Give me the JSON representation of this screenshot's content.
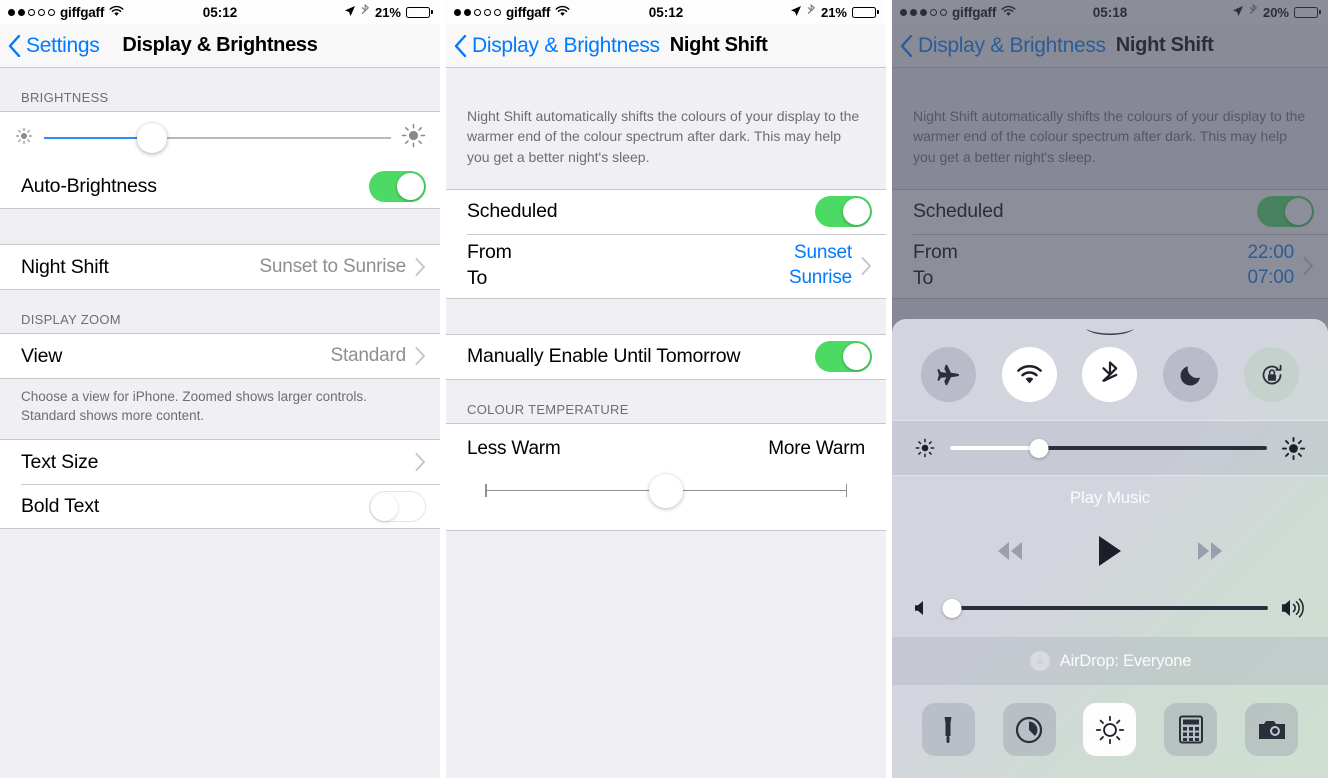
{
  "panels": [
    {
      "status": {
        "carrier": "giffgaff",
        "signal_dots_filled": 2,
        "signal_dots_total": 5,
        "time": "05:12",
        "battery_percent": "21%",
        "battery_level": 21,
        "icons": [
          "wifi-icon",
          "location-arrow-icon",
          "bluetooth-icon",
          "battery-icon"
        ]
      },
      "nav": {
        "back_label": "Settings",
        "title": "Display & Brightness"
      },
      "brightness_header": "BRIGHTNESS",
      "brightness_slider": {
        "value": 31,
        "min_icon": "sun-small-icon",
        "max_icon": "sun-large-icon"
      },
      "auto_brightness": {
        "label": "Auto-Brightness",
        "state": "on"
      },
      "night_shift": {
        "label": "Night Shift",
        "value": "Sunset to Sunrise"
      },
      "display_zoom_header": "DISPLAY ZOOM",
      "view": {
        "label": "View",
        "value": "Standard"
      },
      "view_footnote": "Choose a view for iPhone. Zoomed shows larger controls. Standard shows more content.",
      "text_size": {
        "label": "Text Size"
      },
      "bold_text": {
        "label": "Bold Text",
        "state": "off"
      }
    },
    {
      "status": {
        "carrier": "giffgaff",
        "signal_dots_filled": 2,
        "signal_dots_total": 5,
        "time": "05:12",
        "battery_percent": "21%",
        "battery_level": 21
      },
      "nav": {
        "back_label": "Display & Brightness",
        "title": "Night Shift"
      },
      "description": "Night Shift automatically shifts the colours of your display to the warmer end of the colour spectrum after dark. This may help you get a better night's sleep.",
      "scheduled": {
        "label": "Scheduled",
        "state": "on"
      },
      "schedule": {
        "from_label": "From",
        "to_label": "To",
        "from_value": "Sunset",
        "to_value": "Sunrise"
      },
      "manual": {
        "label": "Manually Enable Until Tomorrow",
        "state": "on"
      },
      "colour_temp_header": "COLOUR TEMPERATURE",
      "colour_temp": {
        "min_label": "Less Warm",
        "max_label": "More Warm",
        "value": 50
      }
    },
    {
      "status": {
        "carrier": "giffgaff",
        "signal_dots_filled": 3,
        "signal_dots_total": 5,
        "time": "05:18",
        "battery_percent": "20%",
        "battery_level": 20
      },
      "nav": {
        "back_label": "Display & Brightness",
        "title": "Night Shift"
      },
      "description": "Night Shift automatically shifts the colours of your display to the warmer end of the colour spectrum after dark. This may help you get a better night's sleep.",
      "scheduled": {
        "label": "Scheduled",
        "state": "on"
      },
      "schedule": {
        "from_label": "From",
        "to_label": "To",
        "from_value": "22:00",
        "to_value": "07:00"
      },
      "control_center": {
        "toggles": [
          {
            "name": "airplane-mode-icon",
            "state": "off"
          },
          {
            "name": "wifi-icon",
            "state": "on"
          },
          {
            "name": "bluetooth-icon",
            "state": "on"
          },
          {
            "name": "do-not-disturb-moon-icon",
            "state": "off"
          },
          {
            "name": "rotation-lock-icon",
            "state": "tinted"
          }
        ],
        "brightness": {
          "value": 28
        },
        "media_title": "Play Music",
        "transport": [
          "rewind-icon",
          "play-icon",
          "fast-forward-icon"
        ],
        "volume": {
          "value": 3
        },
        "airdrop_label": "AirDrop: Everyone",
        "shortcuts": [
          {
            "name": "flashlight-icon",
            "state": "off"
          },
          {
            "name": "timer-icon",
            "state": "off"
          },
          {
            "name": "night-shift-icon",
            "state": "on"
          },
          {
            "name": "calculator-icon",
            "state": "off"
          },
          {
            "name": "camera-icon",
            "state": "off"
          }
        ]
      }
    }
  ],
  "colors": {
    "ios_blue": "#007aff",
    "switch_green": "#4cd964",
    "slider_blue": "#2f8cf5",
    "group_bg": "#efeff4",
    "separator": "#c8c7cc",
    "secondary_text": "#6d6d72",
    "value_text": "#8e8e93"
  }
}
